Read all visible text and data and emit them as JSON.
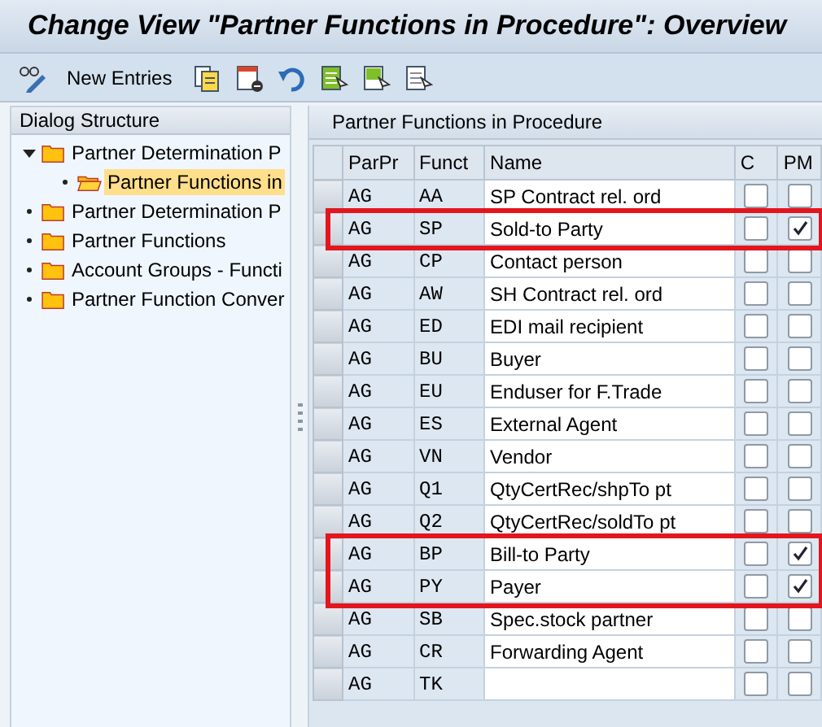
{
  "window": {
    "title": "Change View \"Partner Functions in Procedure\": Overview"
  },
  "toolbar": [
    {
      "kind": "glasses-pencil"
    },
    {
      "kind": "text",
      "label": "New Entries"
    },
    {
      "kind": "copy"
    },
    {
      "kind": "delete"
    },
    {
      "kind": "undo"
    },
    {
      "kind": "select-all"
    },
    {
      "kind": "select-block"
    },
    {
      "kind": "deselect"
    }
  ],
  "dialog_structure": {
    "title": "Dialog Structure",
    "items": [
      {
        "label": "Partner Determination P",
        "expanded": true,
        "selected": false,
        "children": [
          {
            "label": "Partner Functions in",
            "selected": true
          }
        ]
      },
      {
        "label": "Partner Determination P",
        "selected": false
      },
      {
        "label": "Partner Functions",
        "selected": false
      },
      {
        "label": "Account Groups - Functi",
        "selected": false
      },
      {
        "label": "Partner Function Conver",
        "selected": false
      }
    ]
  },
  "table": {
    "title": "Partner Functions in Procedure",
    "columns": [
      "ParPr",
      "Funct",
      "Name",
      "C",
      "PM"
    ],
    "rows": [
      {
        "parpr": "AG",
        "funct": "AA",
        "name": "SP Contract rel. ord",
        "c": false,
        "pm": false,
        "highlighted": false
      },
      {
        "parpr": "AG",
        "funct": "SP",
        "name": "Sold-to Party",
        "c": false,
        "pm": true,
        "highlighted": true
      },
      {
        "parpr": "AG",
        "funct": "CP",
        "name": "Contact person",
        "c": false,
        "pm": false,
        "highlighted": false
      },
      {
        "parpr": "AG",
        "funct": "AW",
        "name": "SH Contract rel. ord",
        "c": false,
        "pm": false,
        "highlighted": false
      },
      {
        "parpr": "AG",
        "funct": "ED",
        "name": "EDI mail recipient",
        "c": false,
        "pm": false,
        "highlighted": false
      },
      {
        "parpr": "AG",
        "funct": "BU",
        "name": "Buyer",
        "c": false,
        "pm": false,
        "highlighted": false
      },
      {
        "parpr": "AG",
        "funct": "EU",
        "name": "Enduser for F.Trade",
        "c": false,
        "pm": false,
        "highlighted": false
      },
      {
        "parpr": "AG",
        "funct": "ES",
        "name": "External Agent",
        "c": false,
        "pm": false,
        "highlighted": false
      },
      {
        "parpr": "AG",
        "funct": "VN",
        "name": "Vendor",
        "c": false,
        "pm": false,
        "highlighted": false
      },
      {
        "parpr": "AG",
        "funct": "Q1",
        "name": "QtyCertRec/shpTo pt",
        "c": false,
        "pm": false,
        "highlighted": false
      },
      {
        "parpr": "AG",
        "funct": "Q2",
        "name": "QtyCertRec/soldTo pt",
        "c": false,
        "pm": false,
        "highlighted": false
      },
      {
        "parpr": "AG",
        "funct": "BP",
        "name": "Bill-to Party",
        "c": false,
        "pm": true,
        "highlighted": true
      },
      {
        "parpr": "AG",
        "funct": "PY",
        "name": "Payer",
        "c": false,
        "pm": true,
        "highlighted": true
      },
      {
        "parpr": "AG",
        "funct": "SB",
        "name": "Spec.stock partner",
        "c": false,
        "pm": false,
        "highlighted": false
      },
      {
        "parpr": "AG",
        "funct": "CR",
        "name": "Forwarding Agent",
        "c": false,
        "pm": false,
        "highlighted": false
      },
      {
        "parpr": "AG",
        "funct": "TK",
        "c": false,
        "pm": false,
        "highlighted": false
      }
    ]
  }
}
